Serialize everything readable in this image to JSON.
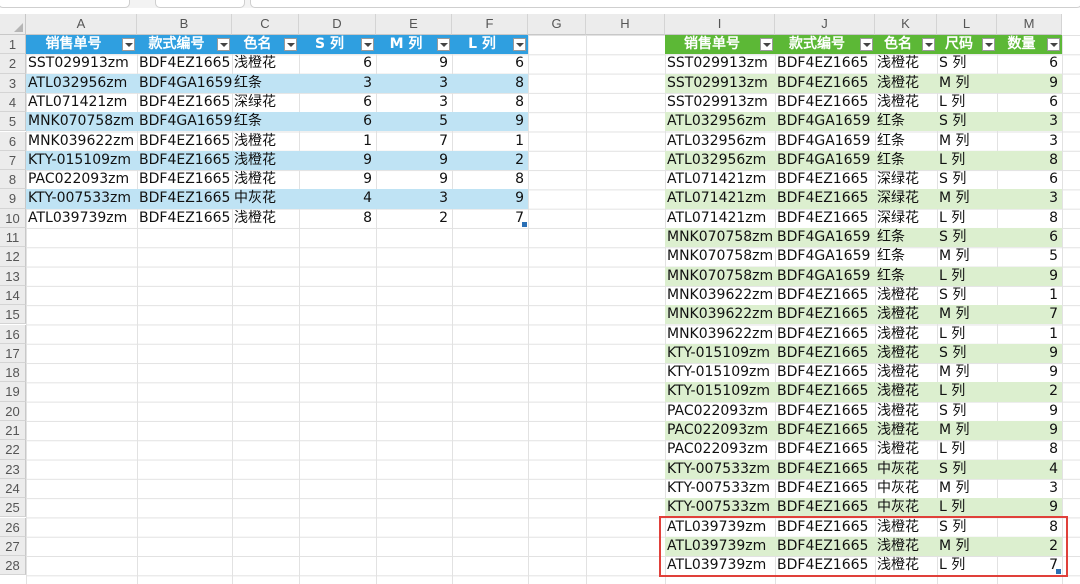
{
  "colors": {
    "left_header": "#2f9fe0",
    "left_band": "#bfe3f4",
    "right_header": "#5cb836",
    "right_band": "#dcefcf",
    "highlight": "#e0403a"
  },
  "columns": [
    "A",
    "B",
    "C",
    "D",
    "E",
    "F",
    "G",
    "H",
    "I",
    "J",
    "K",
    "L",
    "M"
  ],
  "rows": [
    "1",
    "2",
    "3",
    "4",
    "5",
    "6",
    "7",
    "8",
    "9",
    "10",
    "11",
    "12",
    "13",
    "14",
    "15",
    "16",
    "17",
    "18",
    "19",
    "20",
    "21",
    "22",
    "23",
    "24",
    "25",
    "26",
    "27",
    "28"
  ],
  "left_table": {
    "headers": [
      "销售单号",
      "款式编号",
      "色名",
      "S 列",
      "M 列",
      "L 列"
    ],
    "rows": [
      [
        "SST029913zm",
        "BDF4EZ1665",
        "浅橙花",
        "6",
        "9",
        "6"
      ],
      [
        "ATL032956zm",
        "BDF4GA1659",
        "红条",
        "3",
        "3",
        "8"
      ],
      [
        "ATL071421zm",
        "BDF4EZ1665",
        "深绿花",
        "6",
        "3",
        "8"
      ],
      [
        "MNK070758zm",
        "BDF4GA1659",
        "红条",
        "6",
        "5",
        "9"
      ],
      [
        "MNK039622zm",
        "BDF4EZ1665",
        "浅橙花",
        "1",
        "7",
        "1"
      ],
      [
        "KTY-015109zm",
        "BDF4EZ1665",
        "浅橙花",
        "9",
        "9",
        "2"
      ],
      [
        "PAC022093zm",
        "BDF4EZ1665",
        "浅橙花",
        "9",
        "9",
        "8"
      ],
      [
        "KTY-007533zm",
        "BDF4EZ1665",
        "中灰花",
        "4",
        "3",
        "9"
      ],
      [
        "ATL039739zm",
        "BDF4EZ1665",
        "浅橙花",
        "8",
        "2",
        "7"
      ]
    ]
  },
  "right_table": {
    "headers": [
      "销售单号",
      "款式编号",
      "色名",
      "尺码",
      "数量"
    ],
    "rows": [
      [
        "SST029913zm",
        "BDF4EZ1665",
        "浅橙花",
        "S 列",
        "6"
      ],
      [
        "SST029913zm",
        "BDF4EZ1665",
        "浅橙花",
        "M 列",
        "9"
      ],
      [
        "SST029913zm",
        "BDF4EZ1665",
        "浅橙花",
        "L 列",
        "6"
      ],
      [
        "ATL032956zm",
        "BDF4GA1659",
        "红条",
        "S 列",
        "3"
      ],
      [
        "ATL032956zm",
        "BDF4GA1659",
        "红条",
        "M 列",
        "3"
      ],
      [
        "ATL032956zm",
        "BDF4GA1659",
        "红条",
        "L 列",
        "8"
      ],
      [
        "ATL071421zm",
        "BDF4EZ1665",
        "深绿花",
        "S 列",
        "6"
      ],
      [
        "ATL071421zm",
        "BDF4EZ1665",
        "深绿花",
        "M 列",
        "3"
      ],
      [
        "ATL071421zm",
        "BDF4EZ1665",
        "深绿花",
        "L 列",
        "8"
      ],
      [
        "MNK070758zm",
        "BDF4GA1659",
        "红条",
        "S 列",
        "6"
      ],
      [
        "MNK070758zm",
        "BDF4GA1659",
        "红条",
        "M 列",
        "5"
      ],
      [
        "MNK070758zm",
        "BDF4GA1659",
        "红条",
        "L 列",
        "9"
      ],
      [
        "MNK039622zm",
        "BDF4EZ1665",
        "浅橙花",
        "S 列",
        "1"
      ],
      [
        "MNK039622zm",
        "BDF4EZ1665",
        "浅橙花",
        "M 列",
        "7"
      ],
      [
        "MNK039622zm",
        "BDF4EZ1665",
        "浅橙花",
        "L 列",
        "1"
      ],
      [
        "KTY-015109zm",
        "BDF4EZ1665",
        "浅橙花",
        "S 列",
        "9"
      ],
      [
        "KTY-015109zm",
        "BDF4EZ1665",
        "浅橙花",
        "M 列",
        "9"
      ],
      [
        "KTY-015109zm",
        "BDF4EZ1665",
        "浅橙花",
        "L 列",
        "2"
      ],
      [
        "PAC022093zm",
        "BDF4EZ1665",
        "浅橙花",
        "S 列",
        "9"
      ],
      [
        "PAC022093zm",
        "BDF4EZ1665",
        "浅橙花",
        "M 列",
        "9"
      ],
      [
        "PAC022093zm",
        "BDF4EZ1665",
        "浅橙花",
        "L 列",
        "8"
      ],
      [
        "KTY-007533zm",
        "BDF4EZ1665",
        "中灰花",
        "S 列",
        "4"
      ],
      [
        "KTY-007533zm",
        "BDF4EZ1665",
        "中灰花",
        "M 列",
        "3"
      ],
      [
        "KTY-007533zm",
        "BDF4EZ1665",
        "中灰花",
        "L 列",
        "9"
      ],
      [
        "ATL039739zm",
        "BDF4EZ1665",
        "浅橙花",
        "S 列",
        "8"
      ],
      [
        "ATL039739zm",
        "BDF4EZ1665",
        "浅橙花",
        "M 列",
        "2"
      ],
      [
        "ATL039739zm",
        "BDF4EZ1665",
        "浅橙花",
        "L 列",
        "7"
      ]
    ]
  }
}
